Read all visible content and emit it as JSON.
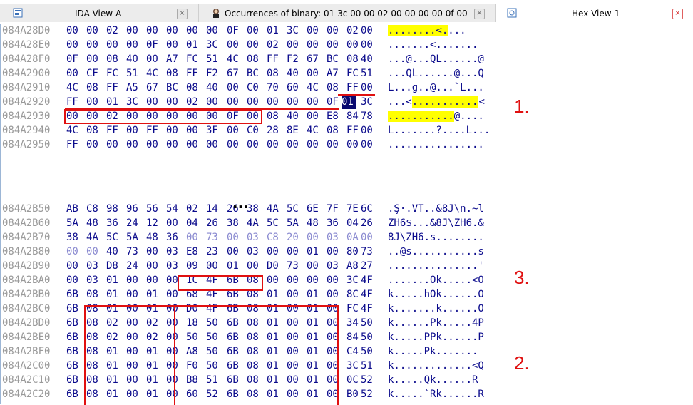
{
  "tabs": [
    {
      "label": "IDA View-A",
      "icon": "ida-view-icon",
      "close": "×"
    },
    {
      "label": "Occurrences of binary: 01 3c 00 00 02 00 00 00 00 0f 00",
      "icon": "occurrences-icon",
      "close": "×"
    },
    {
      "label": "Hex View-1",
      "icon": "hex-view-icon",
      "close": "×"
    }
  ],
  "hex_rows": [
    {
      "addr": "084A28D0",
      "bytes": [
        "00",
        "00",
        "02",
        "00",
        "00",
        "00",
        "00",
        "00",
        "0F",
        "00",
        "01",
        "3C",
        "00",
        "00",
        "02",
        "00"
      ],
      "ascii": "........<....",
      "ascii_hl": [
        0,
        10
      ]
    },
    {
      "addr": "084A28E0",
      "bytes": [
        "00",
        "00",
        "00",
        "00",
        "0F",
        "00",
        "01",
        "3C",
        "00",
        "00",
        "02",
        "00",
        "00",
        "00",
        "00",
        "00"
      ],
      "ascii": ".......<......."
    },
    {
      "addr": "084A28F0",
      "bytes": [
        "0F",
        "00",
        "08",
        "40",
        "00",
        "A7",
        "FC",
        "51",
        "4C",
        "08",
        "FF",
        "F2",
        "67",
        "BC",
        "08",
        "40"
      ],
      "ascii": "...@...QL......@"
    },
    {
      "addr": "084A2900",
      "bytes": [
        "00",
        "CF",
        "FC",
        "51",
        "4C",
        "08",
        "FF",
        "F2",
        "67",
        "BC",
        "08",
        "40",
        "00",
        "A7",
        "FC",
        "51"
      ],
      "ascii": "...QL......@...Q"
    },
    {
      "addr": "084A2910",
      "bytes": [
        "4C",
        "08",
        "FF",
        "A5",
        "67",
        "BC",
        "08",
        "40",
        "00",
        "C0",
        "70",
        "60",
        "4C",
        "08",
        "FF",
        "00"
      ],
      "ascii": "L...g..@...`L..."
    },
    {
      "addr": "084A2920",
      "bytes": [
        "FF",
        "00",
        "01",
        "3C",
        "00",
        "00",
        "02",
        "00",
        "00",
        "00",
        "00",
        "00",
        "00",
        "0F",
        "00",
        "01",
        "3C"
      ],
      "ascii": "...<...........<",
      "ascii_hl": [
        4,
        15
      ]
    },
    {
      "addr": "084A2930",
      "bytes": [
        "00",
        "00",
        "02",
        "00",
        "00",
        "00",
        "00",
        "00",
        "0F",
        "00",
        "08",
        "40",
        "00",
        "E8",
        "84",
        "78"
      ],
      "ascii": "...........@....",
      "ascii_hl": [
        0,
        11
      ]
    },
    {
      "addr": "084A2940",
      "bytes": [
        "4C",
        "08",
        "FF",
        "00",
        "FF",
        "00",
        "00",
        "3F",
        "00",
        "C0",
        "28",
        "8E",
        "4C",
        "08",
        "FF",
        "00"
      ],
      "ascii": "L.......?....L..."
    },
    {
      "addr": "084A2950",
      "bytes": [
        "FF",
        "00",
        "00",
        "00",
        "00",
        "00",
        "00",
        "00",
        "00",
        "00",
        "00",
        "00",
        "00",
        "00",
        "00",
        "00"
      ],
      "ascii": "................"
    },
    {
      "addr": "084A2B50",
      "bytes": [
        "AB",
        "C8",
        "98",
        "96",
        "56",
        "54",
        "02",
        "14",
        "26",
        "38",
        "4A",
        "5C",
        "6E",
        "7F",
        "7E",
        "6C"
      ],
      "ascii": ".Ş·.VT..&8J\\n.~l"
    },
    {
      "addr": "084A2B60",
      "bytes": [
        "5A",
        "48",
        "36",
        "24",
        "12",
        "00",
        "04",
        "26",
        "38",
        "4A",
        "5C",
        "5A",
        "48",
        "36",
        "04",
        "26"
      ],
      "ascii": "ZH6$...&8J\\ZH6.&"
    },
    {
      "addr": "084A2B70",
      "bytes": [
        "38",
        "4A",
        "5C",
        "5A",
        "48",
        "36",
        "00",
        "73",
        "00",
        "03",
        "C8",
        "20",
        "00",
        "03",
        "0A",
        "00"
      ],
      "ascii": "8J\\ZH6.s........",
      "faded": [
        6,
        7,
        8,
        9,
        10,
        11,
        12,
        13,
        14,
        15
      ]
    },
    {
      "addr": "084A2B80",
      "bytes": [
        "00",
        "00",
        "40",
        "73",
        "00",
        "03",
        "E8",
        "23",
        "00",
        "03",
        "00",
        "00",
        "01",
        "00",
        "80",
        "73"
      ],
      "ascii": "..@s...........s",
      "faded": [
        0,
        1
      ]
    },
    {
      "addr": "084A2B90",
      "bytes": [
        "00",
        "03",
        "D8",
        "24",
        "00",
        "03",
        "09",
        "00",
        "01",
        "00",
        "D0",
        "73",
        "00",
        "03",
        "A8",
        "27"
      ],
      "ascii": "...............'"
    },
    {
      "addr": "084A2BA0",
      "bytes": [
        "00",
        "03",
        "01",
        "00",
        "00",
        "00",
        "1C",
        "4F",
        "6B",
        "08",
        "00",
        "00",
        "00",
        "00",
        "3C",
        "4F"
      ],
      "ascii": ".......Ok.....<O"
    },
    {
      "addr": "084A2BB0",
      "bytes": [
        "6B",
        "08",
        "01",
        "00",
        "01",
        "00",
        "68",
        "4F",
        "6B",
        "08",
        "01",
        "00",
        "01",
        "00",
        "8C",
        "4F"
      ],
      "ascii": "k.....hOk......O"
    },
    {
      "addr": "084A2BC0",
      "bytes": [
        "6B",
        "08",
        "01",
        "00",
        "01",
        "00",
        "D0",
        "4F",
        "6B",
        "08",
        "01",
        "00",
        "01",
        "00",
        "FC",
        "4F"
      ],
      "ascii": "k.......k......O"
    },
    {
      "addr": "084A2BD0",
      "bytes": [
        "6B",
        "08",
        "02",
        "00",
        "02",
        "00",
        "18",
        "50",
        "6B",
        "08",
        "01",
        "00",
        "01",
        "00",
        "34",
        "50"
      ],
      "ascii": "k......Pk.....4P"
    },
    {
      "addr": "084A2BE0",
      "bytes": [
        "6B",
        "08",
        "02",
        "00",
        "02",
        "00",
        "50",
        "50",
        "6B",
        "08",
        "01",
        "00",
        "01",
        "00",
        "84",
        "50"
      ],
      "ascii": "k.....PPk......P"
    },
    {
      "addr": "084A2BF0",
      "bytes": [
        "6B",
        "08",
        "01",
        "00",
        "01",
        "00",
        "A8",
        "50",
        "6B",
        "08",
        "01",
        "00",
        "01",
        "00",
        "C4",
        "50"
      ],
      "ascii": "k.....Pk......."
    },
    {
      "addr": "084A2C00",
      "bytes": [
        "6B",
        "08",
        "01",
        "00",
        "01",
        "00",
        "F0",
        "50",
        "6B",
        "08",
        "01",
        "00",
        "01",
        "00",
        "3C",
        "51"
      ],
      "ascii": "k.............<Q"
    },
    {
      "addr": "084A2C10",
      "bytes": [
        "6B",
        "08",
        "01",
        "00",
        "01",
        "00",
        "B8",
        "51",
        "6B",
        "08",
        "01",
        "00",
        "01",
        "00",
        "0C",
        "52"
      ],
      "ascii": "k.....Qk......R"
    },
    {
      "addr": "084A2C20",
      "bytes": [
        "6B",
        "08",
        "01",
        "00",
        "01",
        "00",
        "60",
        "52",
        "6B",
        "08",
        "01",
        "00",
        "01",
        "00",
        "B0",
        "52"
      ],
      "ascii": "k.....`Rk......R"
    }
  ],
  "ellipsis": "...",
  "annotations": [
    "1.",
    "2.",
    "3."
  ],
  "colors": {
    "hex_text": "#0b0b8c",
    "address_text": "#9a9a9a",
    "highlight": "#ffff00",
    "annotation": "#e01010",
    "selection": "#0a0a70"
  }
}
